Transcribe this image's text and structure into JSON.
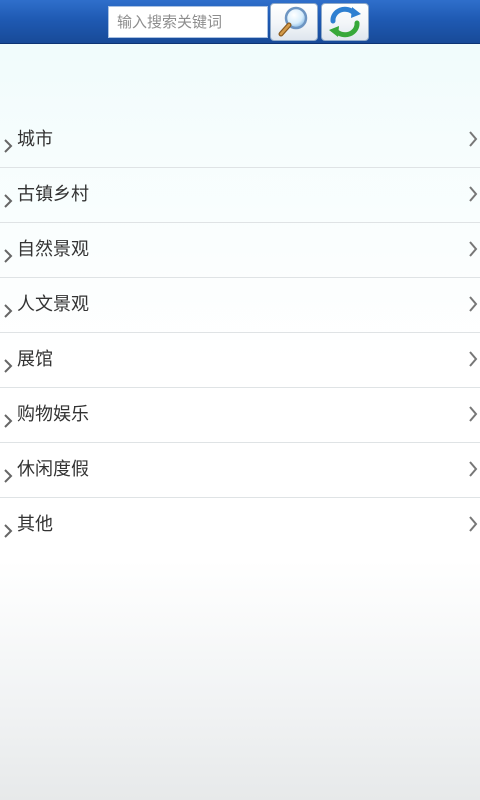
{
  "header": {
    "search": {
      "placeholder": "输入搜索关键词",
      "value": ""
    },
    "search_icon": "magnifier-icon",
    "refresh_icon": "refresh-icon",
    "colors": {
      "bar_top": "#2f6fcb",
      "bar_bottom": "#184a98"
    }
  },
  "categories": [
    {
      "label": "城市"
    },
    {
      "label": "古镇乡村"
    },
    {
      "label": "自然景观"
    },
    {
      "label": "人文景观"
    },
    {
      "label": "展馆"
    },
    {
      "label": "购物娱乐"
    },
    {
      "label": "休闲度假"
    },
    {
      "label": "其他"
    }
  ]
}
